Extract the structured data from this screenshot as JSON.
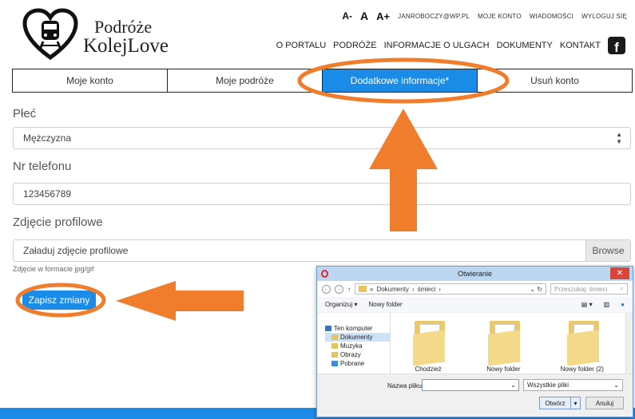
{
  "header": {
    "logo_line1": "Podróże",
    "logo_line2": "KolejLove",
    "font_small": "A-",
    "font_normal": "A",
    "font_large": "A+",
    "email": "JANROBOCZY@WP.PL",
    "my_account": "MOJE KONTO",
    "messages": "WIADOMOŚCI",
    "logout": "WYLOGUJ SIĘ",
    "nav": [
      "O PORTALU",
      "PODRÓŻE",
      "INFORMACJE O ULGACH",
      "DOKUMENTY",
      "KONTAKT"
    ],
    "fb_icon": "facebook-icon"
  },
  "tabs": [
    "Moje konto",
    "Moje podróże",
    "Dodatkowe informacje*",
    "Usuń konto"
  ],
  "active_tab": 2,
  "form": {
    "gender_label": "Płeć",
    "gender_value": "Mężczyzna",
    "phone_label": "Nr telefonu",
    "phone_value": "123456789",
    "photo_label": "Zdjęcie profilowe",
    "photo_placeholder": "Załaduj zdjęcie profilowe",
    "browse": "Browse",
    "hint": "Zdjęcie w formacie jpg/gif",
    "save": "Zapisz zmiany"
  },
  "colors": {
    "accent": "#1a8ce8",
    "annotation": "#f07d2b"
  },
  "dialog": {
    "title": "Otwieranie",
    "path_prefix": "«",
    "path1": "Dokumenty",
    "path2": "śmieci",
    "search_placeholder": "Przeszukaj: śmieci",
    "organize": "Organizuj ▾",
    "new_folder": "Nowy folder",
    "tree": [
      "Ten komputer",
      "Dokumenty",
      "Muzyka",
      "Obrazy",
      "Pobrane"
    ],
    "files": [
      "Chodzież",
      "Nowy folder",
      "Nowy folder (2)"
    ],
    "filename_label": "Nazwa pliku:",
    "filename_value": "",
    "filetype": "Wszystkie pliki",
    "open": "Otwórz",
    "cancel": "Anuluj"
  }
}
